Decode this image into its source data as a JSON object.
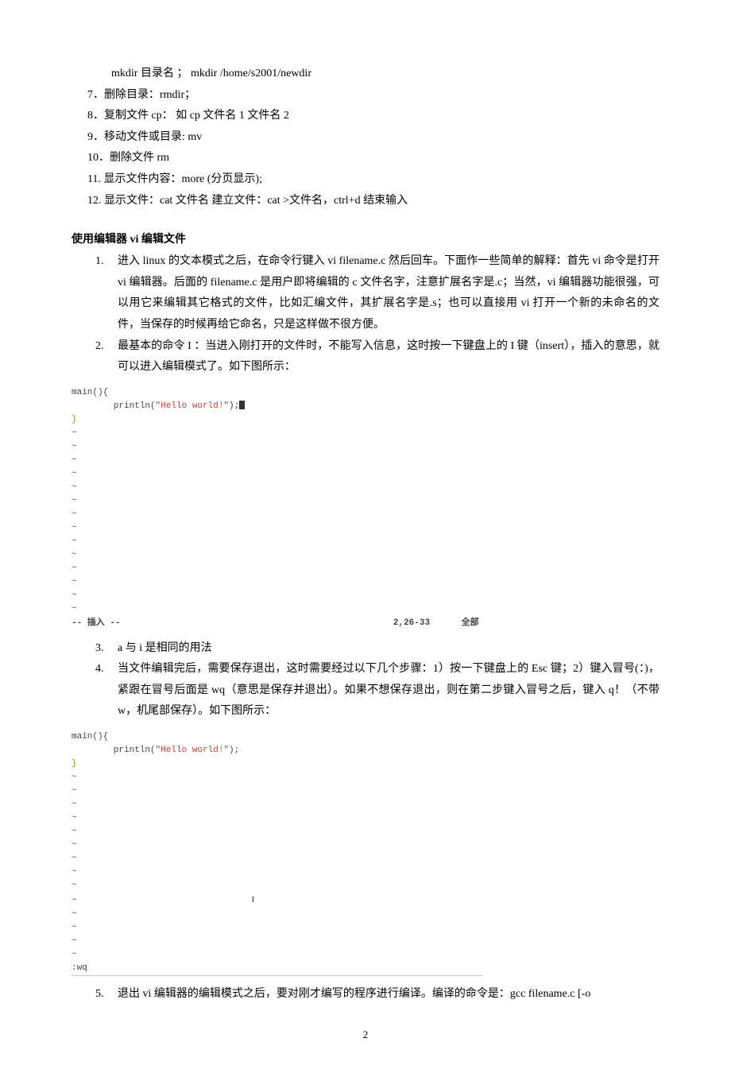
{
  "cmd": {
    "mkdir": "mkdir    目录名  ；      mkdir    /home/s2001/newdir",
    "i7": "7．删除目录：rmdir；",
    "i8": "8．复制文件 cp：  如    cp    文件名 1    文件名 2",
    "i9": "9．移动文件或目录: mv",
    "i10": "10．删除文件    rm",
    "i11": "11.  显示文件内容：more      (分页显示);",
    "i12": "12.  显示文件：cat  文件名      建立文件：cat >文件名，ctrl+d 结束输入"
  },
  "heading": "使用编辑器 vi  编辑文件",
  "vi": {
    "n1": "1.",
    "t1": "进入 linux 的文本模式之后，在命令行键入 vi  filename.c 然后回车。下面作一些简单的解释：首先 vi 命令是打开 vi 编辑器。后面的 filename.c 是用户即将编辑的 c 文件名字，注意扩展名字是.c；当然，vi  编辑器功能很强，可以用它来编辑其它格式的文件，比如汇编文件，其扩展名字是.s；也可以直接用 vi 打开一个新的未命名的文件，当保存的时候再给它命名，只是这样做不很方便。",
    "n2": "2.",
    "t2": "最基本的命令 I ：当进入刚打开的文件时，不能写入信息，这时按一下键盘上的 I 键（insert），插入的意思，就可以进入编辑模式了。如下图所示：",
    "n3": "3.",
    "t3": "a 与 i 是相同的用法",
    "n4": "4.",
    "t4": "当文件编辑完后，需要保存退出，这时需要经过以下几个步骤：1）按一下键盘上的 Esc  键；2）键入冒号(：)，紧跟在冒号后面是 wq（意思是保存并退出）。如果不想保存退出，则在第二步键入冒号之后，键入 q！（不带 w，机尾部保存）。如下图所示：",
    "n5": "5.",
    "t5": "退出 vi 编辑器的编辑模式之后，要对刚才编写的程序进行编译。编译的命令是：gcc  filename.c  [-o"
  },
  "term1": {
    "l1a": "main(){",
    "l2a": "        println(",
    "l2b": "\"Hello world!\"",
    "l2c": ");",
    "l3": "}",
    "status": "-- 插入 --                                                    2,26-33      全部"
  },
  "term2": {
    "l1a": "main(){",
    "l2a": "        println(",
    "l2b": "\"Hello world!\"",
    "l2c": ");",
    "l3": "}",
    "wq": ":wq"
  },
  "ibeam": "I",
  "pagenum": "2"
}
